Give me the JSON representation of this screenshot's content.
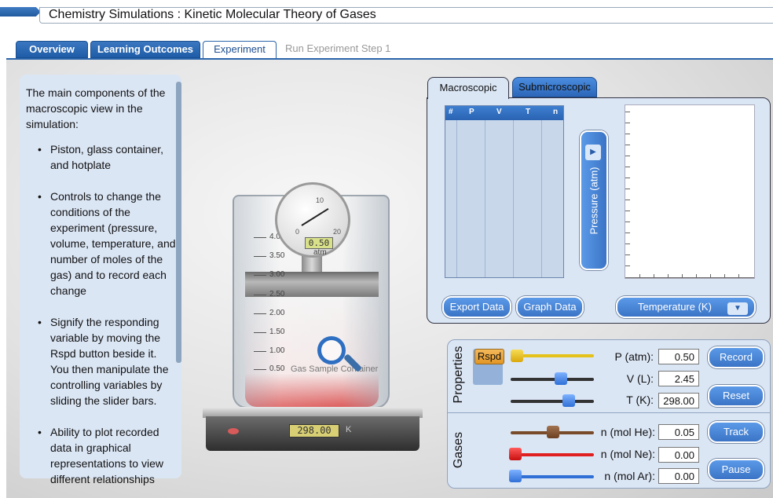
{
  "app": {
    "title": "Chemistry Simulations : Kinetic Molecular Theory of Gases"
  },
  "tabs": [
    {
      "label": "Overview"
    },
    {
      "label": "Learning Outcomes"
    },
    {
      "label": "Experiment"
    },
    {
      "label": "Run Experiment Step 1"
    }
  ],
  "info": {
    "intro": "The main components of the macroscopic view in the simulation:",
    "bullets": [
      "Piston, glass container, and hotplate",
      "Controls to change the conditions of the experiment (pressure, volume, temperature, and number of moles of the gas) and to record each change",
      "Signify the responding variable by moving the Rspd button beside it. You then manipulate the controlling variables by sliding the slider bars.",
      "Ability to plot recorded data in graphical representations to view different relationships"
    ]
  },
  "apparatus": {
    "gauge_reading": "0.50",
    "gauge_unit": "atm",
    "gauge_ticks": [
      "10",
      "20",
      "0"
    ],
    "scale_labels": [
      "4.00",
      "3.50",
      "3.00",
      "2.50",
      "2.00",
      "1.50",
      "1.00",
      "0.50"
    ],
    "container_label": "Gas Sample Container",
    "hotplate_reading": "298.00",
    "hotplate_unit": "K"
  },
  "data_panel": {
    "tab_macroscopic": "Macroscopic",
    "tab_submicroscopic": "Submicroscopic",
    "table_headers": [
      "#",
      "P",
      "V",
      "T",
      "n"
    ],
    "y_axis_label": "Pressure (atm)",
    "x_axis_label": "Temperature (K)",
    "export_button": "Export Data",
    "graph_button": "Graph Data",
    "arrow_right_icon": "play-icon",
    "arrow_down_icon": "chevron-down-icon"
  },
  "controls": {
    "properties_label": "Properties",
    "gases_label": "Gases",
    "rspd_label": "Rspd",
    "pressure_label": "P (atm):",
    "pressure_value": "0.50",
    "volume_label": "V (L):",
    "volume_value": "2.45",
    "temperature_label": "T (K):",
    "temperature_value": "298.00",
    "he_label": "n (mol He):",
    "he_value": "0.05",
    "ne_label": "n (mol Ne):",
    "ne_value": "0.00",
    "ar_label": "n (mol Ar):",
    "ar_value": "0.00",
    "record_button": "Record",
    "reset_button": "Reset",
    "track_button": "Track",
    "pause_button": "Pause",
    "colors": {
      "pressure": "#e5c21a",
      "he": "#7a4b2a",
      "ne": "#e02020",
      "ar": "#2f6fd6"
    }
  }
}
